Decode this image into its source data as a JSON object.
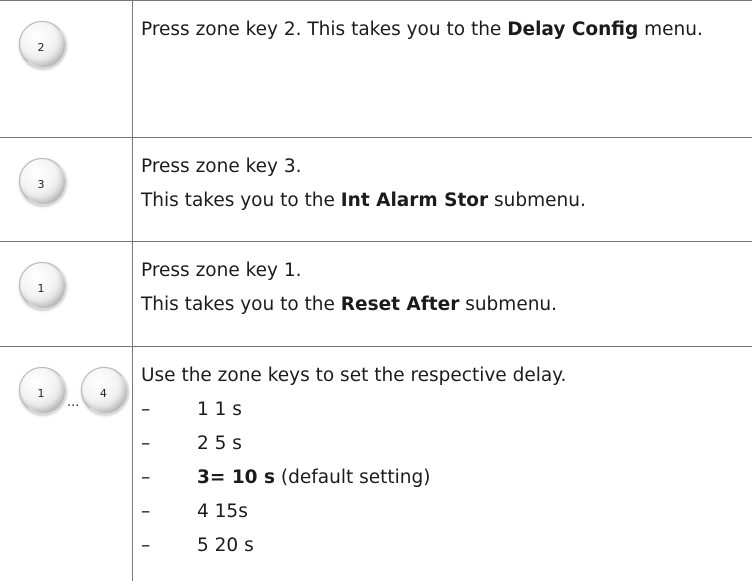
{
  "rows": [
    {
      "keys": [
        "2"
      ],
      "text": {
        "pre": "Press zone key 2. This takes you to the ",
        "bold": "Delay Config",
        "post": " menu."
      }
    },
    {
      "keys": [
        "3"
      ],
      "line1": "Press zone key 3.",
      "text": {
        "pre": "This takes you to the ",
        "bold": "Int Alarm Stor",
        "post": " submenu."
      }
    },
    {
      "keys": [
        "1"
      ],
      "line1": "Press zone key 1.",
      "text": {
        "pre": "This takes you to the ",
        "bold": "Reset After",
        "post": " submenu."
      }
    },
    {
      "keys": [
        "1",
        "4"
      ],
      "range_separator": "...",
      "line1": "Use the zone keys to set the respective delay.",
      "list_marker": "–",
      "options": [
        {
          "text": "1 1 s"
        },
        {
          "text": "2 5 s"
        },
        {
          "bold": "3= 10 s",
          "post": " (default setting)"
        },
        {
          "text": "4 15s"
        },
        {
          "text": "5 20 s"
        }
      ]
    }
  ]
}
